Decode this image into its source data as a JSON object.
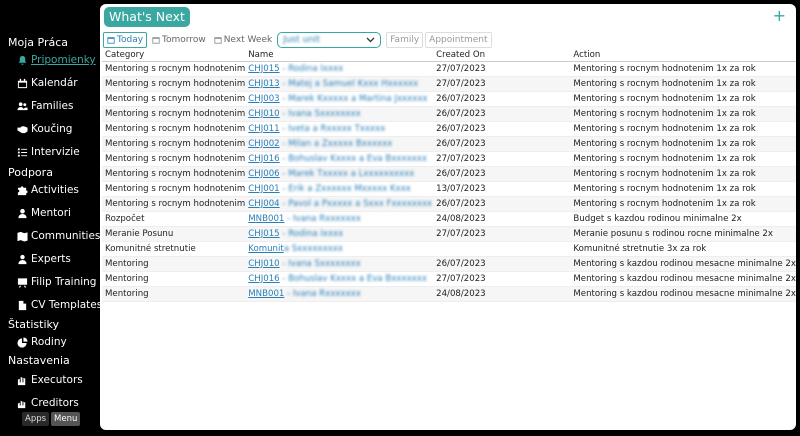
{
  "sidebar": {
    "sections": [
      {
        "title": "Moja Práca"
      },
      {
        "title": "Podpora"
      },
      {
        "title": "Štatistiky"
      },
      {
        "title": "Nastavenia"
      }
    ],
    "items": [
      {
        "label": "Pripomienky",
        "icon": "bell-icon",
        "active": true
      },
      {
        "label": "Kalendár",
        "icon": "calendar-icon"
      },
      {
        "label": "Families",
        "icon": "users-icon"
      },
      {
        "label": "Koučing",
        "icon": "handshake-icon"
      },
      {
        "label": "Intervizie",
        "icon": "list-icon"
      },
      {
        "label": "Activities",
        "icon": "puzzle-icon"
      },
      {
        "label": "Mentori",
        "icon": "user-icon"
      },
      {
        "label": "Communities",
        "icon": "map-icon"
      },
      {
        "label": "Experts",
        "icon": "user-tie-icon"
      },
      {
        "label": "Filip Training",
        "icon": "chalkboard-icon"
      },
      {
        "label": "CV Templates",
        "icon": "file-icon"
      },
      {
        "label": "Rodiny",
        "icon": "pie-chart-icon"
      },
      {
        "label": "Executors",
        "icon": "hands-icon"
      },
      {
        "label": "Creditors",
        "icon": "creditors-icon"
      }
    ],
    "bottom": {
      "apps": "Apps",
      "menu": "Menu"
    }
  },
  "main": {
    "title": "What's Next",
    "add_symbol": "+",
    "filters": {
      "today": "Today",
      "tomorrow": "Tomorrow",
      "next_week": "Next Week",
      "select_value": "Just unit",
      "family": "Family",
      "appointment": "Appointment"
    },
    "columns": [
      "Category",
      "Name",
      "Created On",
      "Action"
    ],
    "rows": [
      {
        "category": "Mentoring s rocnym hodnotenim",
        "code": "CHJ015",
        "rest": " - Rodina Ixxxx",
        "created": "27/07/2023",
        "action": "Mentoring s rocnym hodnotenim 1x za rok"
      },
      {
        "category": "Mentoring s rocnym hodnotenim",
        "code": "CHJ013",
        "rest": " - Matej a Samuel Kxxx Hxxxxxx",
        "created": "27/07/2023",
        "action": "Mentoring s rocnym hodnotenim 1x za rok"
      },
      {
        "category": "Mentoring s rocnym hodnotenim",
        "code": "CHJ003",
        "rest": " - Marek Kxxxxx a Martina Jxxxxxx",
        "created": "26/07/2023",
        "action": "Mentoring s rocnym hodnotenim 1x za rok"
      },
      {
        "category": "Mentoring s rocnym hodnotenim",
        "code": "CHJ010",
        "rest": " - Ivana Sxxxxxxxx",
        "created": "26/07/2023",
        "action": "Mentoring s rocnym hodnotenim 1x za rok"
      },
      {
        "category": "Mentoring s rocnym hodnotenim",
        "code": "CHJ011",
        "rest": " - Iveta a Rxxxxx Txxxxx",
        "created": "26/07/2023",
        "action": "Mentoring s rocnym hodnotenim 1x za rok"
      },
      {
        "category": "Mentoring s rocnym hodnotenim",
        "code": "CHJ002",
        "rest": " - Milan a Zxxxxx Bxxxxxx",
        "created": "26/07/2023",
        "action": "Mentoring s rocnym hodnotenim 1x za rok"
      },
      {
        "category": "Mentoring s rocnym hodnotenim",
        "code": "CHJ016",
        "rest": " - Bohuslav Kxxxx a Eva Bxxxxxxx",
        "created": "27/07/2023",
        "action": "Mentoring s rocnym hodnotenim 1x za rok"
      },
      {
        "category": "Mentoring s rocnym hodnotenim",
        "code": "CHJ006",
        "rest": " - Marek Txxxxx a Lxxxxxxxxxx",
        "created": "26/07/2023",
        "action": "Mentoring s rocnym hodnotenim 1x za rok"
      },
      {
        "category": "Mentoring s rocnym hodnotenim",
        "code": "CHJ001",
        "rest": " - Erik a Zxxxxxx Mxxxxx Kxxx",
        "created": "13/07/2023",
        "action": "Mentoring s rocnym hodnotenim 1x za rok"
      },
      {
        "category": "Mentoring s rocnym hodnotenim",
        "code": "CHJ004",
        "rest": " - Pavol a Pxxxxx a Sxxx Fxxxxxxxx",
        "created": "26/07/2023",
        "action": "Mentoring s rocnym hodnotenim 1x za rok"
      },
      {
        "category": "Rozpočet",
        "code": "MNB001",
        "rest": " - Ivana Rxxxxxxx",
        "created": "24/08/2023",
        "action": "Budget s kazdou rodinou minimalne 2x"
      },
      {
        "category": "Meranie Posunu",
        "code": "CHJ015",
        "rest": " - Rodina Ixxxx",
        "created": "27/07/2023",
        "action": "Meranie posunu s rodinou rocne minimalne 2x"
      },
      {
        "category": "Komunitné stretnutie",
        "code": "Komunit",
        "rest": "a Sxxxxxxxxx",
        "created": "",
        "action": "Komunitné stretnutie 3x za rok"
      },
      {
        "category": "Mentoring",
        "code": "CHJ010",
        "rest": " - Ivana Sxxxxxxxx",
        "created": "26/07/2023",
        "action": "Mentoring s kazdou rodinou mesacne minimalne 2x"
      },
      {
        "category": "Mentoring",
        "code": "CHJ016",
        "rest": " - Bohuslav Kxxxx a Eva Bxxxxxxx",
        "created": "27/07/2023",
        "action": "Mentoring s kazdou rodinou mesacne minimalne 2x"
      },
      {
        "category": "Mentoring",
        "code": "MNB001",
        "rest": " - Ivana Rxxxxxxx",
        "created": "24/08/2023",
        "action": "Mentoring s kazdou rodinou mesacne minimalne 2x"
      }
    ]
  },
  "colors": {
    "accent": "#3aa8a0",
    "link": "#2a7fb8",
    "sidebar_bg": "#000000"
  }
}
